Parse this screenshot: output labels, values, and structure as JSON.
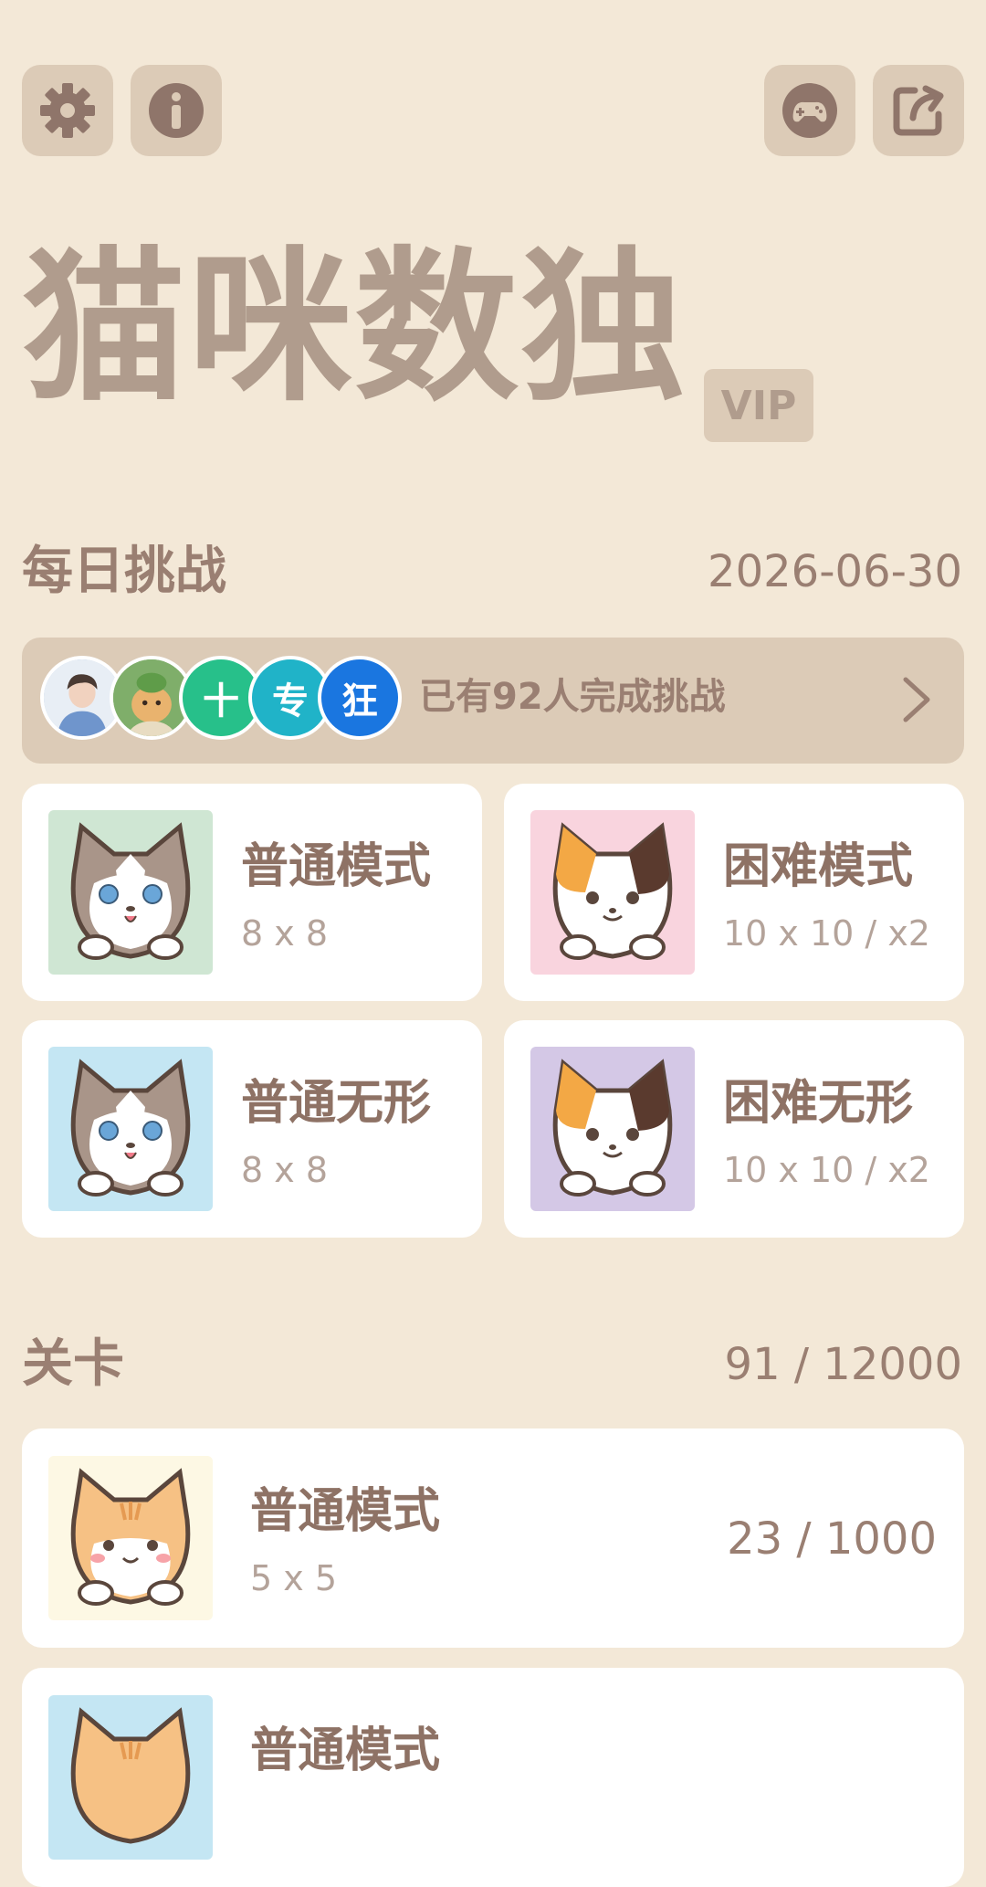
{
  "header": {
    "title": "猫咪数独",
    "vip_badge": "VIP",
    "buttons": {
      "settings": "gear-icon",
      "info": "info-icon",
      "games": "gamepad-icon",
      "share": "share-icon"
    }
  },
  "daily": {
    "section_title": "每日挑战",
    "date": "2026-06-30",
    "completion_text": "已有92人完成挑战",
    "avatars": [
      {
        "label": "",
        "color": "#a9c4e6"
      },
      {
        "label": "",
        "color": "#7fae6a"
      },
      {
        "label": "十",
        "color": "#27c08a"
      },
      {
        "label": "专",
        "color": "#20b3c8"
      },
      {
        "label": "狂",
        "color": "#1a76e0"
      }
    ],
    "modes": [
      {
        "title": "普通模式",
        "size": "8 x 8",
        "bg": "#cfe6d3"
      },
      {
        "title": "困难模式",
        "size": "10 x 10 / x2",
        "bg": "#f9d4de"
      },
      {
        "title": "普通无形",
        "size": "8 x 8",
        "bg": "#c4e6f3"
      },
      {
        "title": "困难无形",
        "size": "10 x 10 / x2",
        "bg": "#d4c8e6"
      }
    ]
  },
  "levels": {
    "section_title": "关卡",
    "progress": "91 / 12000",
    "items": [
      {
        "title": "普通模式",
        "size": "5 x 5",
        "progress": "23 / 1000",
        "bg": "#fdf8e4"
      },
      {
        "title": "普通模式",
        "size": "",
        "progress": "",
        "bg": "#c4e6f3"
      }
    ]
  },
  "colors": {
    "background": "#f3e8d7",
    "button_bg": "#dccbb7",
    "title_text": "#b09c8d",
    "accent_text": "#9a7f72"
  }
}
